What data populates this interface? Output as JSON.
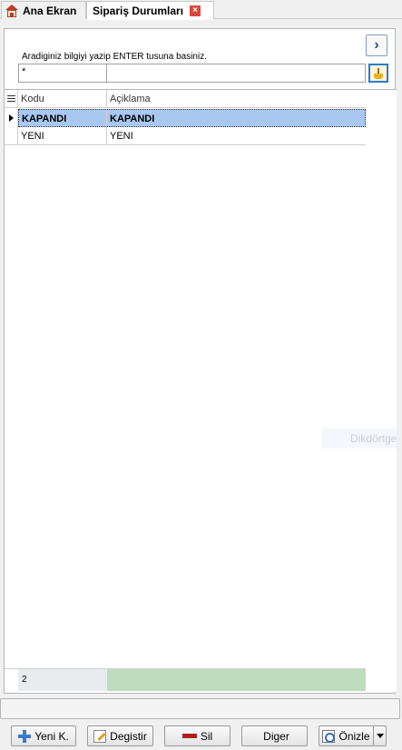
{
  "tabs": {
    "home_label": "Ana Ekran",
    "active_label": "Sipariş Durumları",
    "close_symbol": "×"
  },
  "search": {
    "nav_symbol": "›",
    "hint": "Aradiginiz bilgiyi yazip ENTER tusuna basiniz.",
    "code_value": "*",
    "desc_value": ""
  },
  "grid": {
    "columns": [
      "Kodu",
      "Açiklama"
    ],
    "rows": [
      {
        "code": "KAPANDI",
        "desc": "KAPANDI",
        "selected": true
      },
      {
        "code": "YENI",
        "desc": "YENI",
        "selected": false
      }
    ],
    "record_count": "2"
  },
  "watermark": "Dikdörtgen",
  "buttons": {
    "new": "Yeni K.",
    "edit": "Degistir",
    "delete": "Sil",
    "other": "Diger",
    "preview": "Önizle"
  },
  "colors": {
    "selected_row": "#a9c8f0",
    "footer_green": "#bfdcbe",
    "close_red": "#d9473c",
    "accent_blue": "#2a7bd3"
  }
}
